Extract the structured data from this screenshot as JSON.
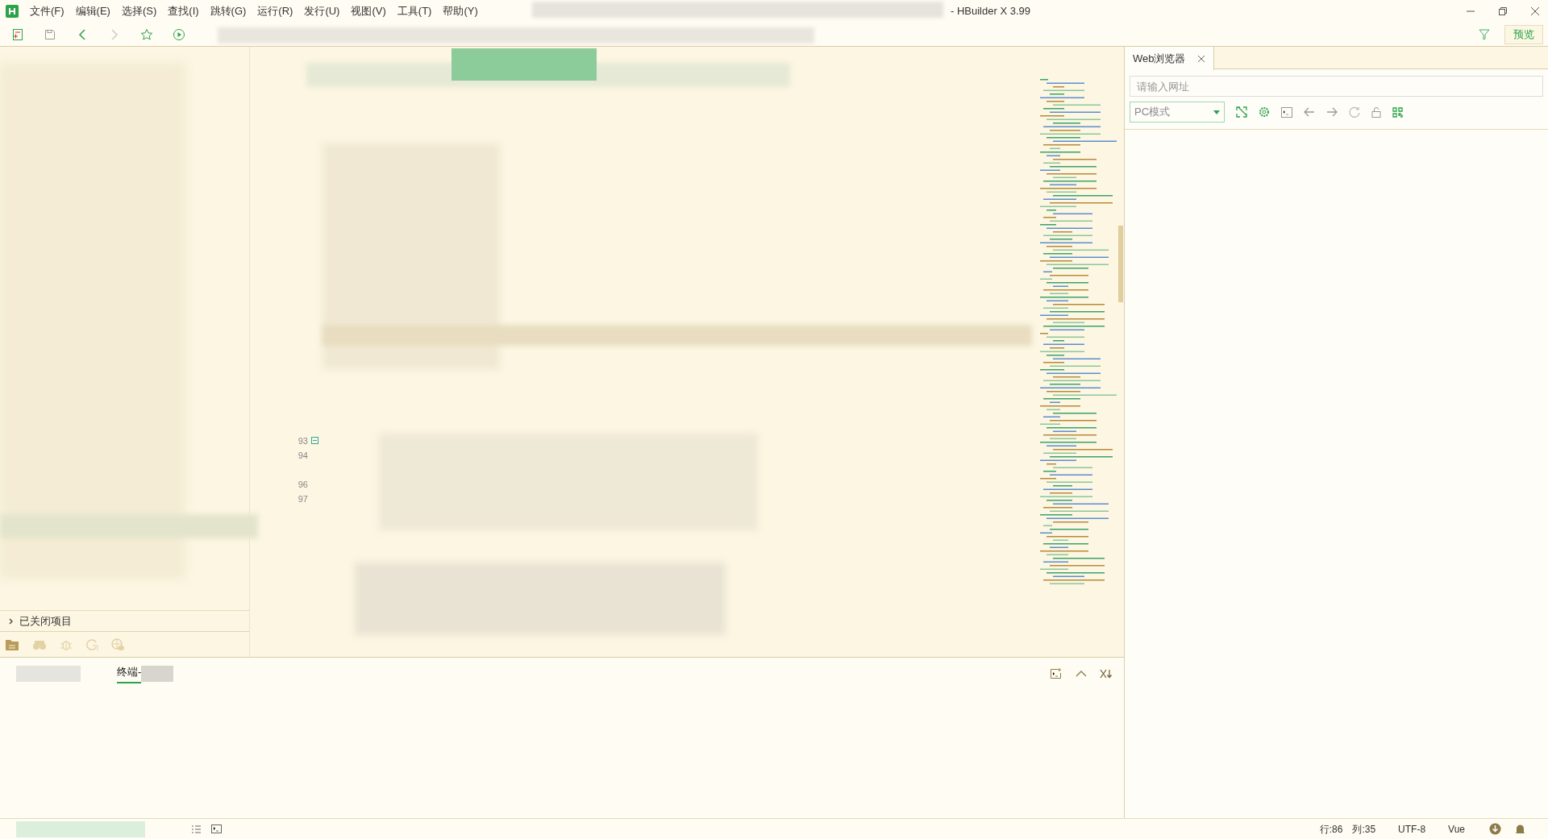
{
  "menu": [
    {
      "label": "文件(F)"
    },
    {
      "label": "编辑(E)"
    },
    {
      "label": "选择(S)"
    },
    {
      "label": "查找(I)"
    },
    {
      "label": "跳转(G)"
    },
    {
      "label": "运行(R)"
    },
    {
      "label": "发行(U)"
    },
    {
      "label": "视图(V)"
    },
    {
      "label": "工具(T)"
    },
    {
      "label": "帮助(Y)"
    }
  ],
  "window": {
    "title": "- HBuilder X 3.99"
  },
  "preview_button": "预览",
  "sidebar": {
    "closed_projects": {
      "label": "已关闭项目",
      "expanded": false
    }
  },
  "gutter": [
    {
      "number": "93",
      "kind": "fold"
    },
    {
      "number": "94",
      "kind": "plain"
    },
    {
      "kind": "blank"
    },
    {
      "number": "96",
      "kind": "plain"
    },
    {
      "number": "97",
      "kind": "plain"
    }
  ],
  "browser": {
    "tab": {
      "label": "Web浏览器"
    },
    "url_field": {
      "placeholder": "请输入网址"
    },
    "mode_select": {
      "value": "PC模式"
    }
  },
  "bottom_panel": {
    "tabs": [
      {
        "label": "终端-",
        "selected": true
      }
    ]
  },
  "status_bar": {
    "line": "行:86",
    "column": "列:35",
    "encoding": "UTF-8",
    "language": "Vue"
  }
}
